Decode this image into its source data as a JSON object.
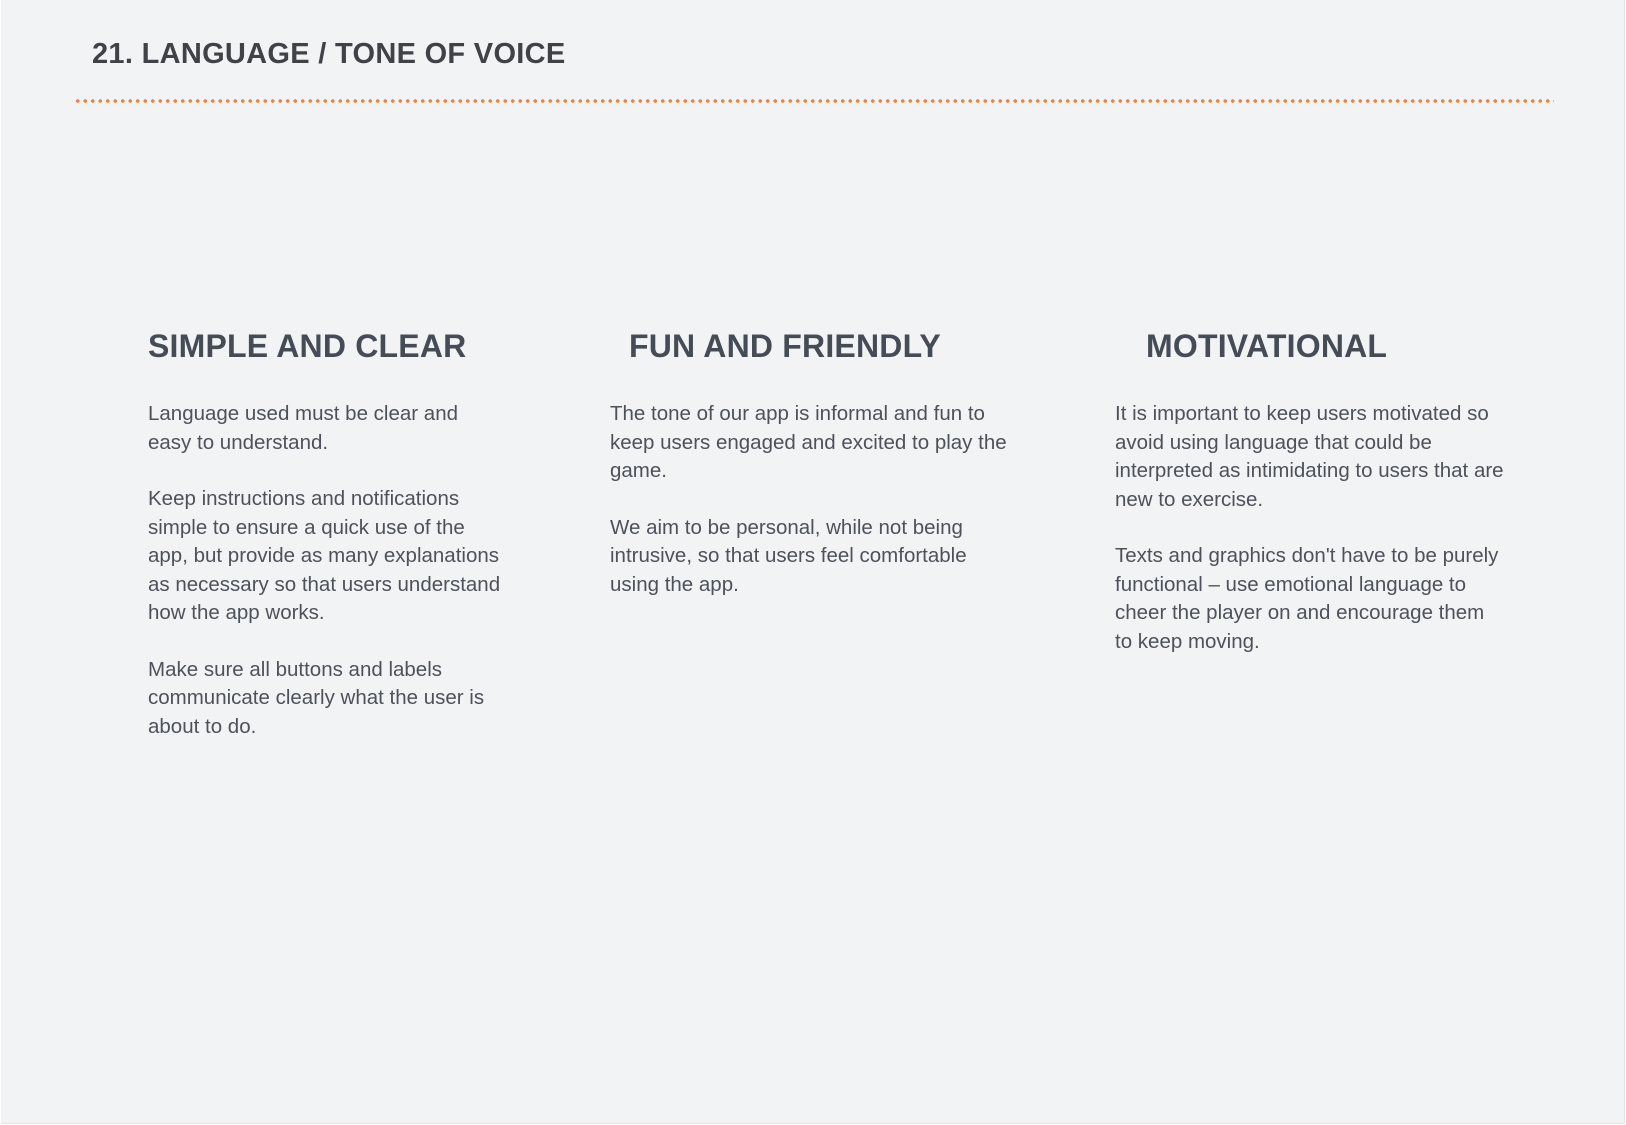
{
  "page": {
    "title": "21. LANGUAGE / TONE OF VOICE",
    "accent_color": "#f0833a",
    "background_color": "#f2f3f5",
    "heading_color": "#454c56",
    "text_color": "#4d525a"
  },
  "columns": [
    {
      "heading": "SIMPLE AND CLEAR",
      "paragraphs": [
        "Language used must be clear and easy to understand.",
        "Keep instructions and notifications simple to ensure a quick use of the app, but provide as many explanations as necessary so that users understand how the app works.",
        "Make sure  all buttons and labels communicate clearly what the user is about to do."
      ]
    },
    {
      "heading": "FUN AND FRIENDLY",
      "paragraphs": [
        "The tone of our app is informal and fun to keep users engaged and excited to play the game.",
        "We aim to be personal, while not being intrusive, so that users feel comfortable using the app."
      ]
    },
    {
      "heading": "MOTIVATIONAL",
      "paragraphs": [
        "It is important to keep users motivated so avoid using language that could be interpreted as intimidating to users that are new to exercise.",
        "Texts and graphics don't have to be purely functional – use emotional language to cheer the player on and encourage them to keep moving."
      ]
    }
  ]
}
